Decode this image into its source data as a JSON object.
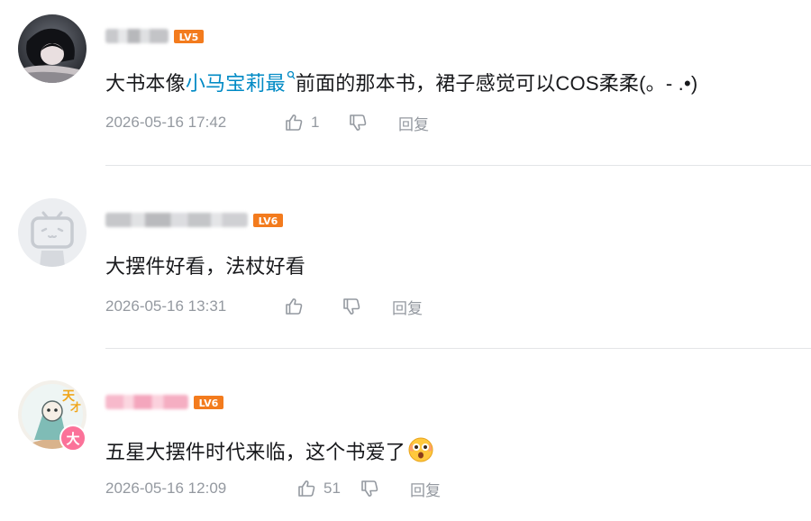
{
  "comments": [
    {
      "level_badge": "LV5",
      "text_before": "大书本像",
      "mention": "小马宝莉最",
      "text_after": "前面的那本书，裙子感觉可以COS柔柔(。- .•)",
      "time": "2026-05-16 17:42",
      "like_count": "1",
      "reply_label": "回复"
    },
    {
      "level_badge": "LV6",
      "text": "大摆件好看，法杖好看",
      "time": "2026-05-16 13:31",
      "like_count": "",
      "reply_label": "回复"
    },
    {
      "level_badge": "LV6",
      "avatar_badge": "大",
      "text": "五星大摆件时代来临，这个书爱了",
      "time": "2026-05-16 12:09",
      "like_count": "51",
      "reply_label": "回复"
    }
  ],
  "colors": {
    "level_badge": "#f37b1d",
    "mention": "#008ac5",
    "meta_text": "#9499a0",
    "divider": "#e3e5e7",
    "main_text": "#18191c"
  },
  "icons": [
    "thumb-up-icon",
    "thumb-down-icon",
    "search-mention-icon",
    "astonished-emoji-icon"
  ]
}
